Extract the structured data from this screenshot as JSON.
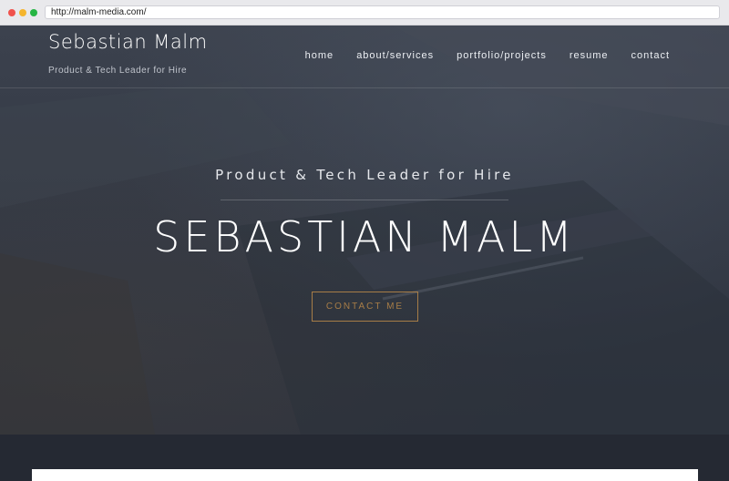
{
  "browser": {
    "url": "http://malm-media.com/"
  },
  "header": {
    "brand": "Sebastian Malm",
    "tagline": "Product & Tech Leader for Hire",
    "nav": [
      {
        "label": "home"
      },
      {
        "label": "about/services"
      },
      {
        "label": "portfolio/projects"
      },
      {
        "label": "resume"
      },
      {
        "label": "contact"
      }
    ]
  },
  "hero": {
    "subtitle": "Product & Tech Leader for Hire",
    "title": "SEBASTIAN MALM",
    "cta_label": "CONTACT ME"
  },
  "colors": {
    "accent": "#a77d47",
    "hero_overlay": "#343a46",
    "page_dark": "#252933"
  }
}
